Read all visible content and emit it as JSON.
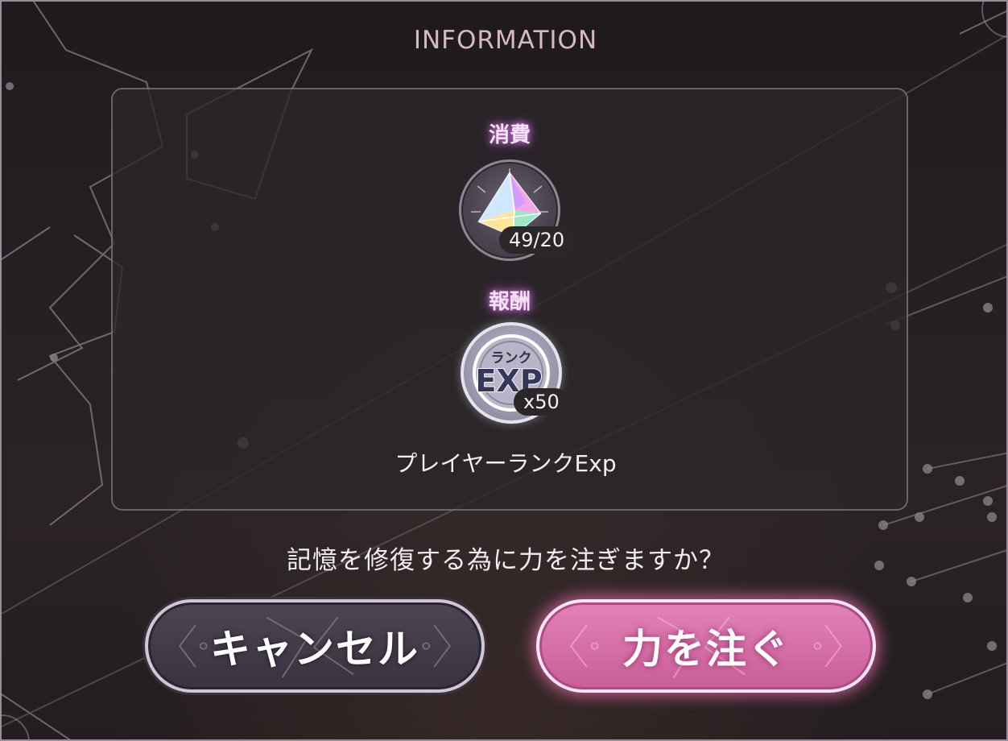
{
  "dialog": {
    "title": "INFORMATION",
    "cost": {
      "label": "消費",
      "icon": "prism-crystal-icon",
      "count": "49/20"
    },
    "reward": {
      "label": "報酬",
      "icon": "rank-exp-icon",
      "icon_top_text": "ランク",
      "icon_main_text": "EXP",
      "count": "x50",
      "name": "プレイヤーランクExp"
    },
    "question": "記憶を修復する為に力を注ぎますか？",
    "buttons": {
      "cancel": "キャンセル",
      "confirm": "力を注ぐ"
    }
  },
  "colors": {
    "accent_pink": "#d96fa8",
    "label_glow": "#d16bd8",
    "frame": "#9a8c99"
  }
}
